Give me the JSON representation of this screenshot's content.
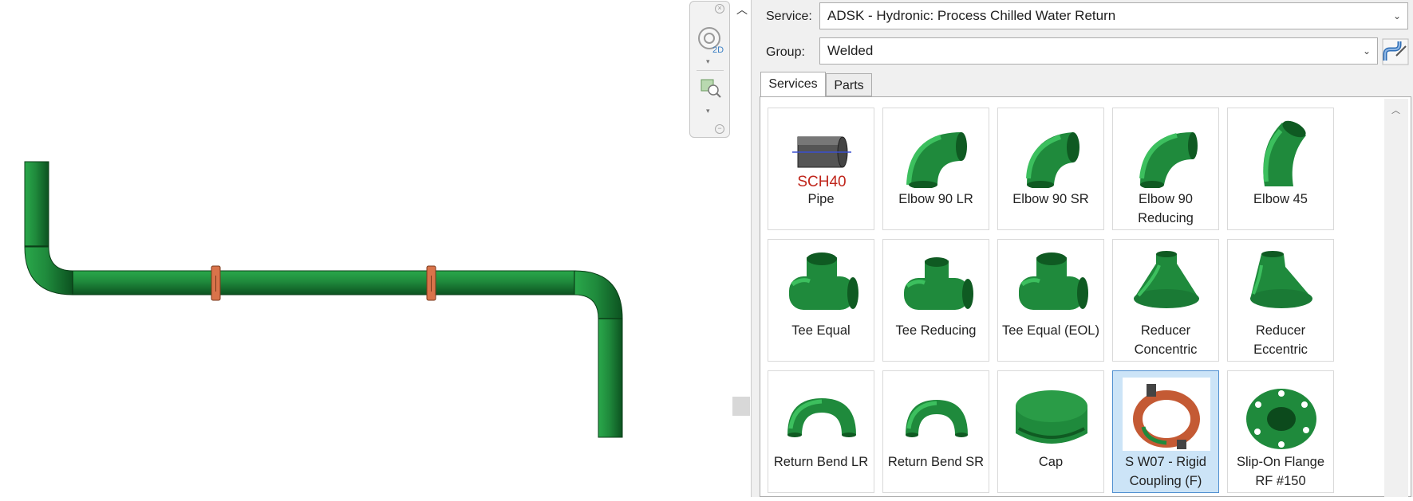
{
  "navigation_bar": {
    "wheel_label": "2D"
  },
  "properties": {
    "service_label": "Service:",
    "service_value": "ADSK - Hydronic: Process Chilled Water Return",
    "group_label": "Group:",
    "group_value": "Welded"
  },
  "tabs": [
    {
      "label": "Services"
    },
    {
      "label": "Parts"
    }
  ],
  "pipe_badge": "SCH40",
  "parts": [
    {
      "name": "Pipe",
      "icon": "pipe-icon"
    },
    {
      "name": "Elbow 90 LR",
      "icon": "elbow-90-lr-icon"
    },
    {
      "name": "Elbow 90 SR",
      "icon": "elbow-90-sr-icon"
    },
    {
      "name": "Elbow 90 Reducing",
      "icon": "elbow-90-reducing-icon"
    },
    {
      "name": "Elbow 45",
      "icon": "elbow-45-icon"
    },
    {
      "name": "Tee Equal",
      "icon": "tee-equal-icon"
    },
    {
      "name": "Tee Reducing",
      "icon": "tee-reducing-icon"
    },
    {
      "name": "Tee Equal (EOL)",
      "icon": "tee-equal-eol-icon"
    },
    {
      "name": "Reducer Concentric",
      "icon": "reducer-concentric-icon"
    },
    {
      "name": "Reducer Eccentric",
      "icon": "reducer-eccentric-icon"
    },
    {
      "name": "Return Bend LR",
      "icon": "return-bend-lr-icon"
    },
    {
      "name": "Return Bend SR",
      "icon": "return-bend-sr-icon"
    },
    {
      "name": "Cap",
      "icon": "cap-icon"
    },
    {
      "name": "S W07 - Rigid Coupling (F)",
      "icon": "rigid-coupling-icon",
      "selected": true
    },
    {
      "name": "Slip-On Flange RF #150",
      "icon": "slip-on-flange-icon"
    }
  ],
  "colors": {
    "pipe_green": "#1f8a3c",
    "pipe_dark": "#0f5a22",
    "coupling_orange": "#d9734a",
    "badge_red": "#c0261c",
    "selection": "#cce4f7"
  }
}
